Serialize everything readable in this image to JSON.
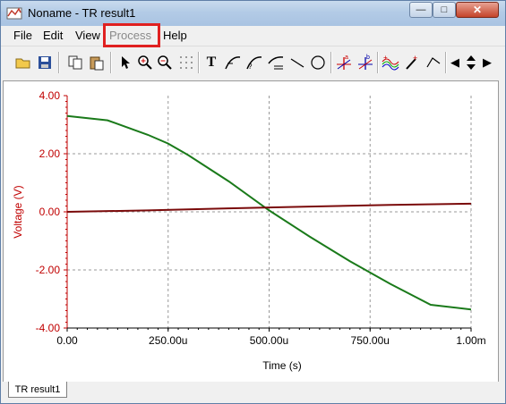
{
  "window": {
    "title": "Noname - TR result1"
  },
  "menu": [
    {
      "label": "File",
      "disabled": false
    },
    {
      "label": "Edit",
      "disabled": false
    },
    {
      "label": "View",
      "disabled": false
    },
    {
      "label": "Process",
      "disabled": true
    },
    {
      "label": "Help",
      "disabled": false
    }
  ],
  "toolbar": [
    "open-icon",
    "save-icon",
    "copy-icon",
    "paste-icon",
    "pointer-icon",
    "zoom-in-icon",
    "zoom-out-icon",
    "grid-icon",
    "text-icon",
    "curve-marker-icon",
    "curve-info-icon",
    "curve-value-icon",
    "line-icon",
    "ellipse-icon",
    "cursor-a-icon",
    "cursor-b-icon",
    "curves-icon",
    "probe-icon",
    "step-icon",
    "arrow-left-icon",
    "arrow-updown-icon",
    "arrow-right-icon"
  ],
  "tabs": [
    {
      "label": "TR result1"
    }
  ],
  "chart_data": {
    "type": "line",
    "xlabel": "Time (s)",
    "ylabel": "Voltage (V)",
    "xlim": [
      0,
      0.001
    ],
    "ylim": [
      -4,
      4
    ],
    "x_ticks": [
      "0.00",
      "250.00u",
      "500.00u",
      "750.00u",
      "1.00m"
    ],
    "y_ticks": [
      "4.00",
      "2.00",
      "0.00",
      "-2.00",
      "-4.00"
    ],
    "grid": true,
    "series": [
      {
        "color": "#1a7a1a",
        "x": [
          0,
          0.0001,
          0.0002,
          0.00025,
          0.0003,
          0.0004,
          0.0005,
          0.0006,
          0.0007,
          0.0008,
          0.0009,
          0.001
        ],
        "y": [
          3.3,
          3.15,
          2.65,
          2.35,
          1.95,
          1.05,
          0.05,
          -0.85,
          -1.7,
          -2.48,
          -3.2,
          -3.36
        ]
      },
      {
        "color": "#7a0a0a",
        "x": [
          0,
          0.0002,
          0.0004,
          0.0006,
          0.0008,
          0.001
        ],
        "y": [
          0,
          0.05,
          0.12,
          0.18,
          0.24,
          0.28
        ]
      }
    ]
  }
}
